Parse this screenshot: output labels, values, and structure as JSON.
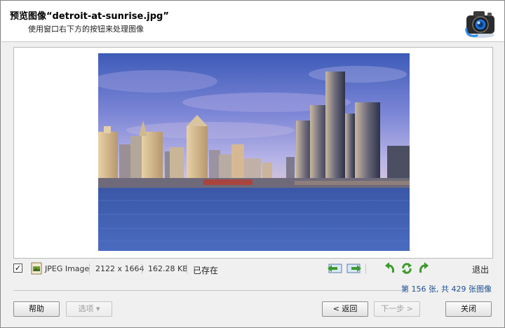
{
  "header": {
    "title": "预览图像“detroit-at-sunrise.jpg”",
    "subtitle": "使用窗口右下方的按钮来处理图像",
    "icon": "camera-icon"
  },
  "preview": {
    "image_alt": "detroit skyline at sunrise"
  },
  "infobar": {
    "checked": true,
    "checkbox_mark": "✓",
    "file_type": "JPEG Image",
    "dimensions": "2122 x 1664",
    "file_size": "162.28 KB",
    "status": "已存在",
    "exit_label": "退出"
  },
  "counter": "第 156 张, 共 429 张图像",
  "buttons": {
    "help": "帮助",
    "options": "选项 ▾",
    "back": "< 返回",
    "next": "下一步 >",
    "close": "关闭"
  },
  "colors": {
    "accent": "#1b4f8f",
    "arrow_green": "#3c9a2c"
  }
}
